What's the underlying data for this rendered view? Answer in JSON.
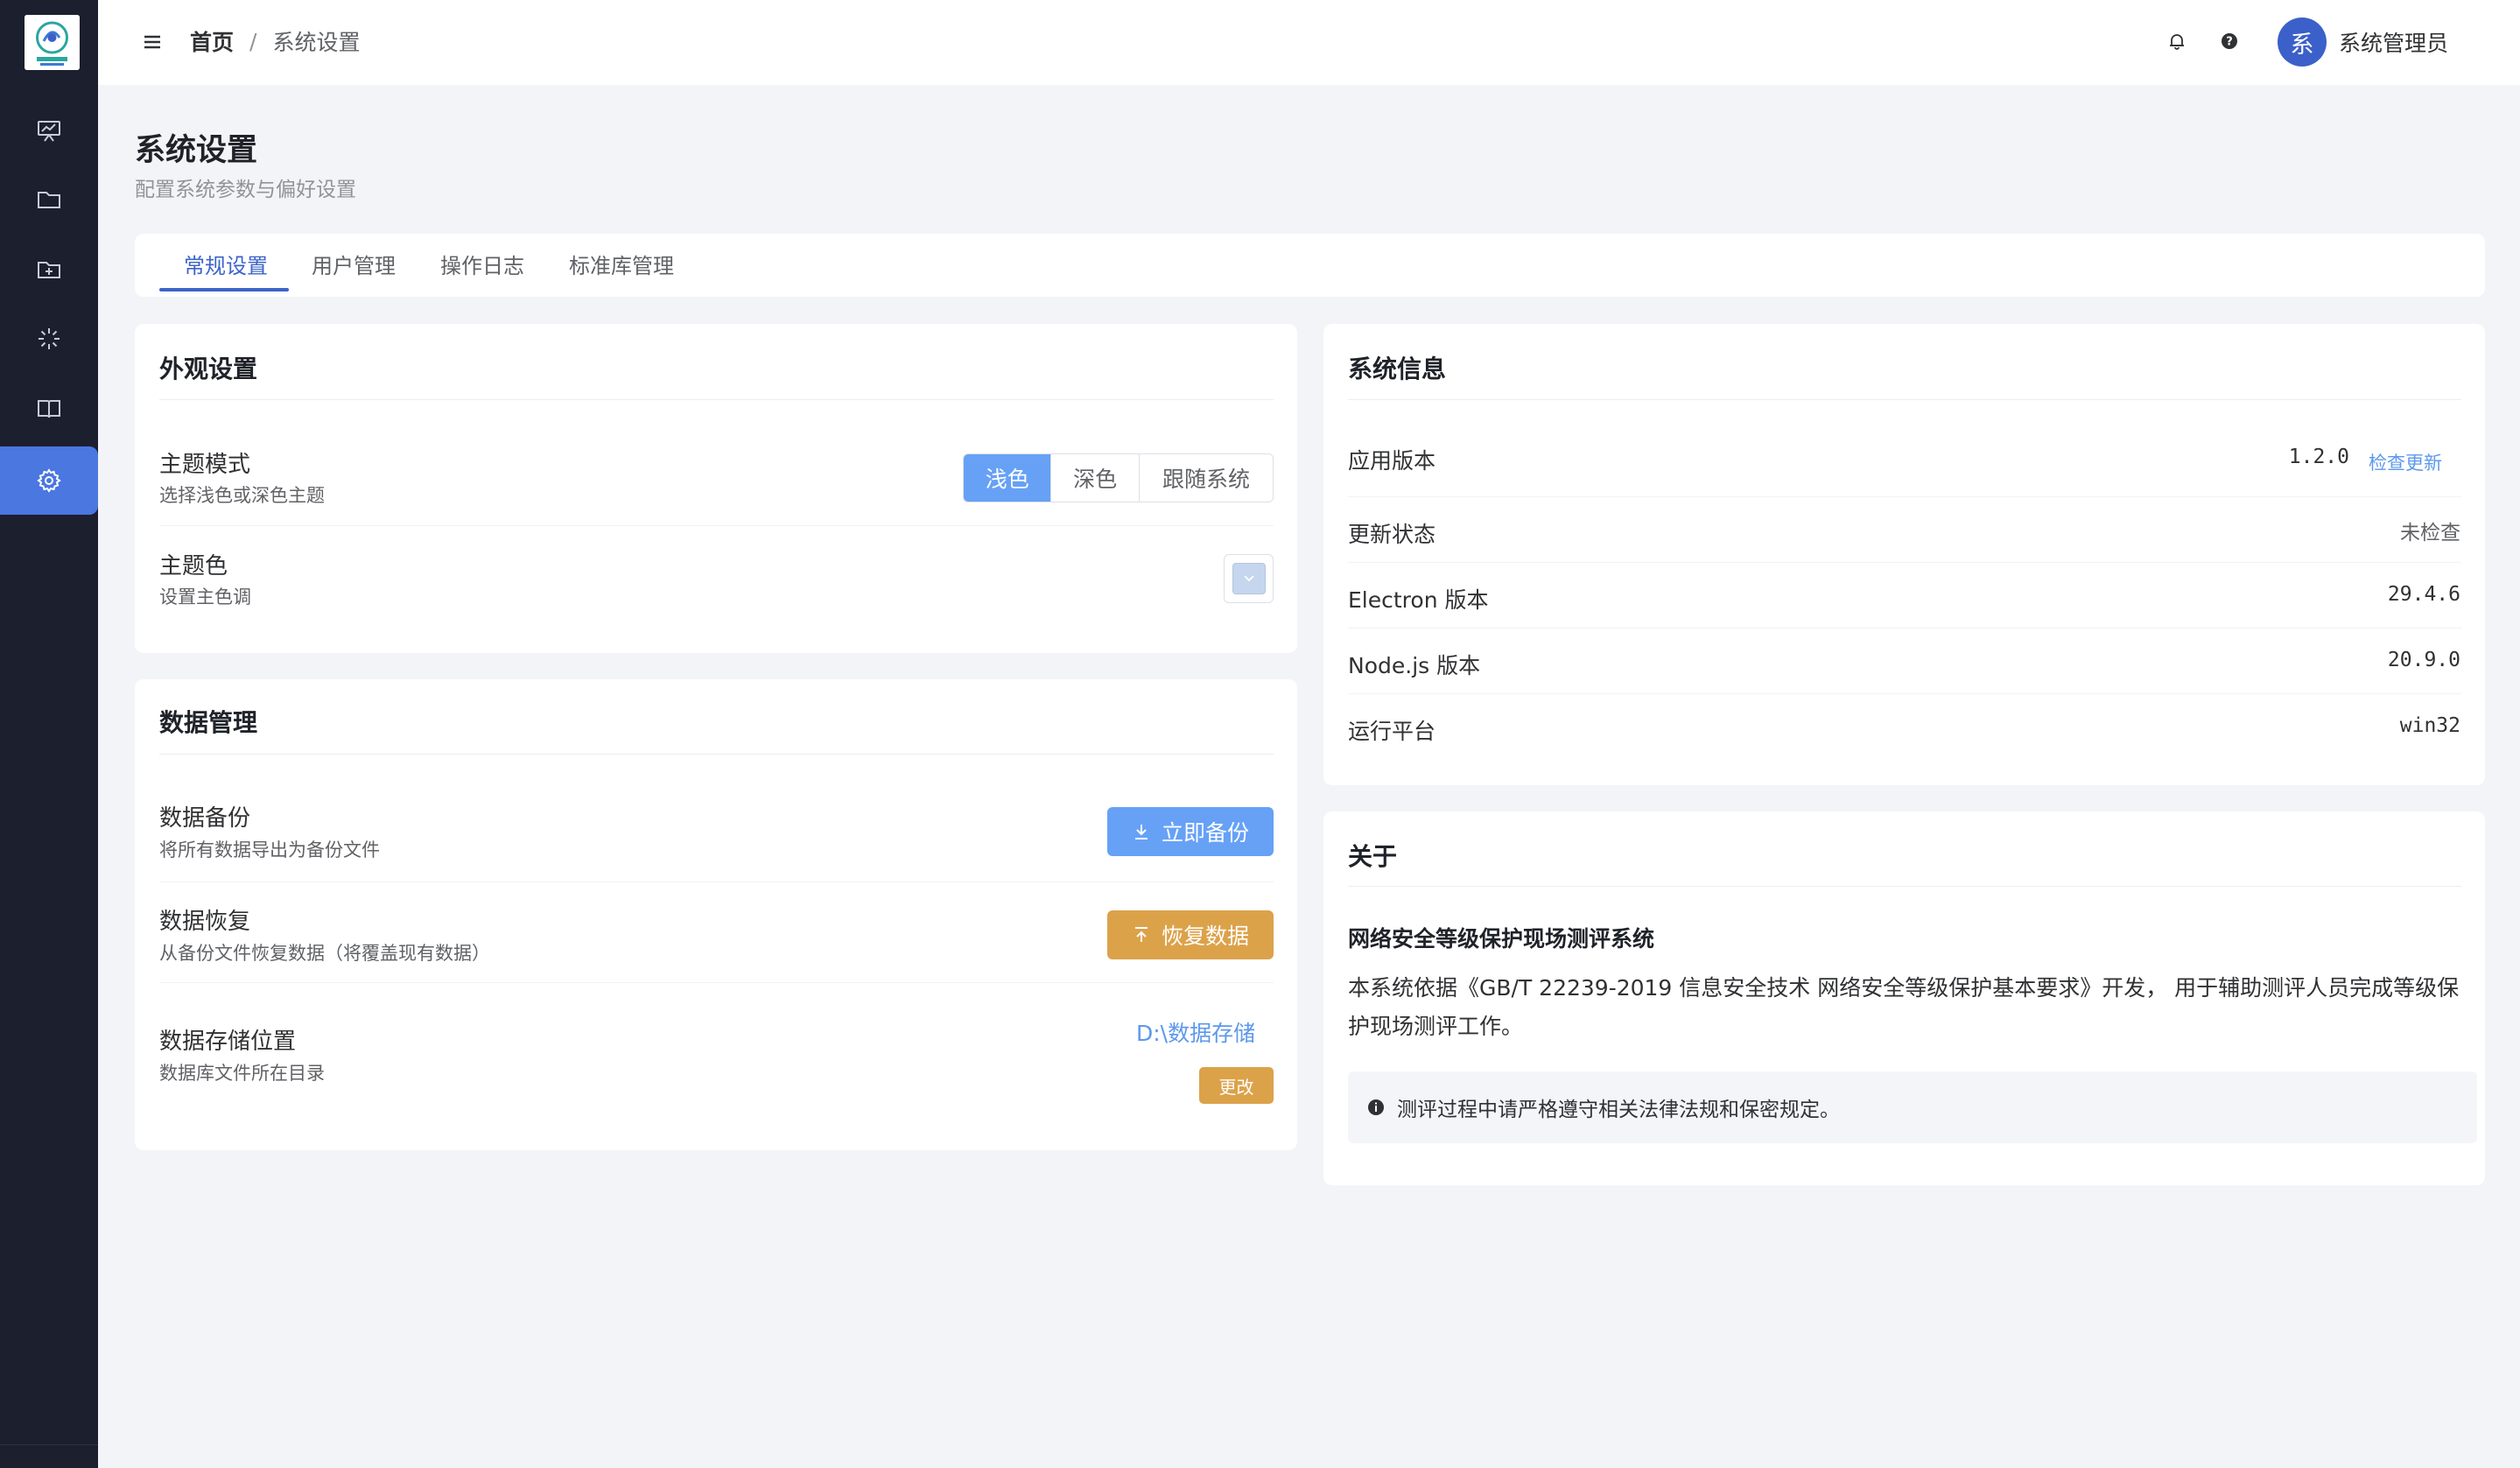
{
  "header": {
    "breadcrumb_home": "首页",
    "breadcrumb_sep": "/",
    "breadcrumb_current": "系统设置",
    "avatar_text": "系",
    "user_name": "系统管理员"
  },
  "page": {
    "title": "系统设置",
    "subtitle": "配置系统参数与偏好设置"
  },
  "tabs": [
    {
      "label": "常规设置",
      "active": true
    },
    {
      "label": "用户管理",
      "active": false
    },
    {
      "label": "操作日志",
      "active": false
    },
    {
      "label": "标准库管理",
      "active": false
    }
  ],
  "appearance": {
    "title": "外观设置",
    "theme_mode_label": "主题模式",
    "theme_mode_desc": "选择浅色或深色主题",
    "theme_options": [
      "浅色",
      "深色",
      "跟随系统"
    ],
    "theme_selected": "浅色",
    "theme_color_label": "主题色",
    "theme_color_desc": "设置主色调",
    "theme_color_value": "#c5d6ee"
  },
  "data_mgmt": {
    "title": "数据管理",
    "backup_label": "数据备份",
    "backup_desc": "将所有数据导出为备份文件",
    "backup_button": "立即备份",
    "restore_label": "数据恢复",
    "restore_desc": "从备份文件恢复数据（将覆盖现有数据）",
    "restore_button": "恢复数据",
    "storage_label": "数据存储位置",
    "storage_desc": "数据库文件所在目录",
    "storage_path": "D:\\数据存储",
    "change_button": "更改"
  },
  "system_info": {
    "title": "系统信息",
    "rows": [
      {
        "label": "应用版本",
        "value": "1.2.0"
      },
      {
        "label": "更新状态",
        "value": "未检查"
      },
      {
        "label": "Electron 版本",
        "value": "29.4.6"
      },
      {
        "label": "Node.js 版本",
        "value": "20.9.0"
      },
      {
        "label": "运行平台",
        "value": "win32"
      }
    ],
    "check_update": "检查更新"
  },
  "about": {
    "title": "关于",
    "heading": "网络安全等级保护现场测评系统",
    "text": "本系统依据《GB/T 22239-2019 信息安全技术 网络安全等级保护基本要求》开发， 用于辅助测评人员完成等级保护现场测评工作。",
    "notice": "测评过程中请严格遵守相关法律法规和保密规定。"
  },
  "colors": {
    "sidebar_bg": "#1c1f2e",
    "primary": "#3c64c8",
    "button_blue": "#66a1f6",
    "button_orange": "#dca24a",
    "link": "#5c98ec"
  },
  "icons": {
    "nav": [
      "chart-board-icon",
      "folder-icon",
      "folder-add-icon",
      "loading-icon",
      "book-icon",
      "gear-icon"
    ]
  }
}
